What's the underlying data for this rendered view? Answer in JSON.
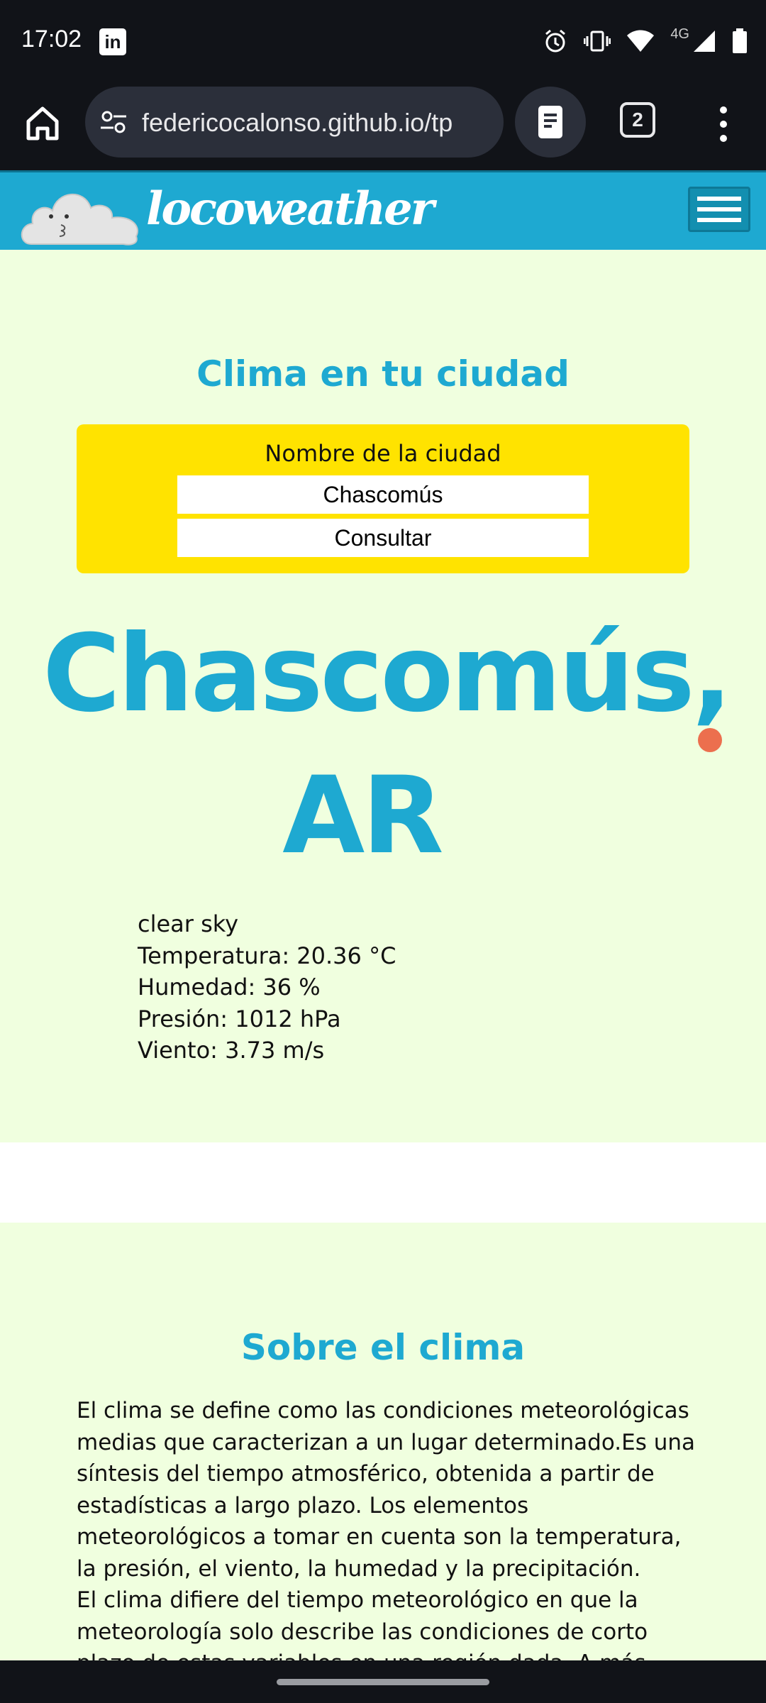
{
  "status_bar": {
    "time": "17:02",
    "app_icon": "linkedin-icon",
    "network_label": "4G",
    "icons": [
      "alarm-icon",
      "vibrate-icon",
      "wifi-icon",
      "signal-icon",
      "battery-icon"
    ]
  },
  "browser": {
    "url": "federicocalonso.github.io/tp",
    "tab_count": "2"
  },
  "site": {
    "logo_text": "locoweather",
    "brand_color": "#1ea9d1",
    "accent_color": "#ffe300"
  },
  "weather_form": {
    "title": "Clima en tu ciudad",
    "label": "Nombre de la ciudad",
    "city_value": "Chascomús",
    "button_label": "Consultar"
  },
  "result": {
    "city": "Chascomús, AR",
    "description": "clear sky",
    "temperature": "Temperatura: 20.36 °C",
    "humidity": "Humedad: 36 %",
    "pressure": "Presión: 1012 hPa",
    "wind": "Viento: 3.73 m/s"
  },
  "about": {
    "title": "Sobre el clima",
    "paragraph1": "El clima se define como las condiciones meteorológicas medias que caracterizan a un lugar determinado.Es una síntesis del tiempo atmosférico, obtenida a partir de estadísticas a largo plazo. Los elementos meteorológicos a tomar en cuenta son la temperatura, la presión, el viento, la humedad y la precipitación.",
    "paragraph2": "El clima difiere del tiempo meteorológico en que la meteorología solo describe las condiciones de corto plazo de estas variables en una región dada. A más"
  }
}
